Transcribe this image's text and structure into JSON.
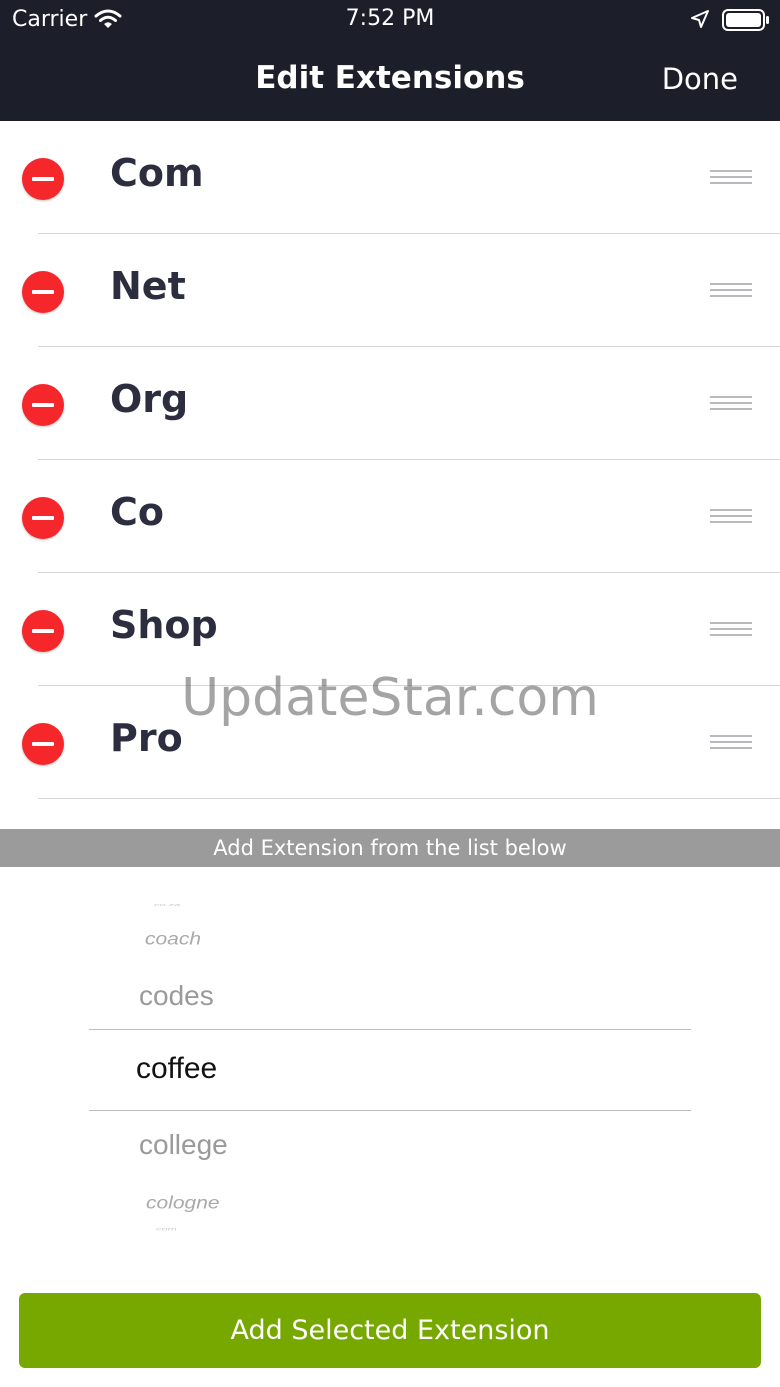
{
  "status_bar": {
    "carrier": "Carrier",
    "time": "7:52 PM"
  },
  "nav": {
    "title": "Edit Extensions",
    "done_label": "Done"
  },
  "extensions": [
    {
      "label": "Com"
    },
    {
      "label": "Net"
    },
    {
      "label": "Org"
    },
    {
      "label": "Co"
    },
    {
      "label": "Shop"
    },
    {
      "label": "Pro"
    }
  ],
  "watermark": "UpdateStar.com",
  "add_banner": "Add Extension from the list below",
  "picker": {
    "options": [
      "co.za",
      "coach",
      "codes",
      "coffee",
      "college",
      "cologne",
      "com"
    ],
    "selected": "coffee"
  },
  "add_button_label": "Add Selected Extension",
  "colors": {
    "navbar_bg": "#1c1f2a",
    "delete_red": "#f5272b",
    "banner_gray": "#9b9b9b",
    "button_green": "#76a800"
  }
}
